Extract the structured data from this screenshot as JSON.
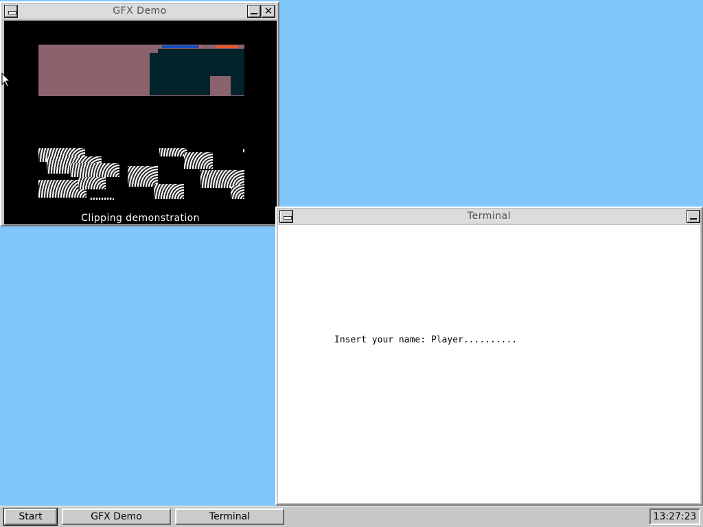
{
  "desktop": {
    "background": "#80c6fb"
  },
  "windows": {
    "gfx": {
      "title": "GFX Demo",
      "caption": "Clipping demonstration",
      "colors": {
        "mauve": "#8a636d",
        "teal": "#03232a",
        "blue": "#1a4fc2",
        "orange": "#e8562f"
      }
    },
    "terminal": {
      "title": "Terminal",
      "prompt_label": "Insert your name: ",
      "prompt_value": "Player.........."
    }
  },
  "taskbar": {
    "start_label": "Start",
    "tasks": [
      "GFX Demo",
      "Terminal"
    ],
    "clock": "13:27:23"
  }
}
